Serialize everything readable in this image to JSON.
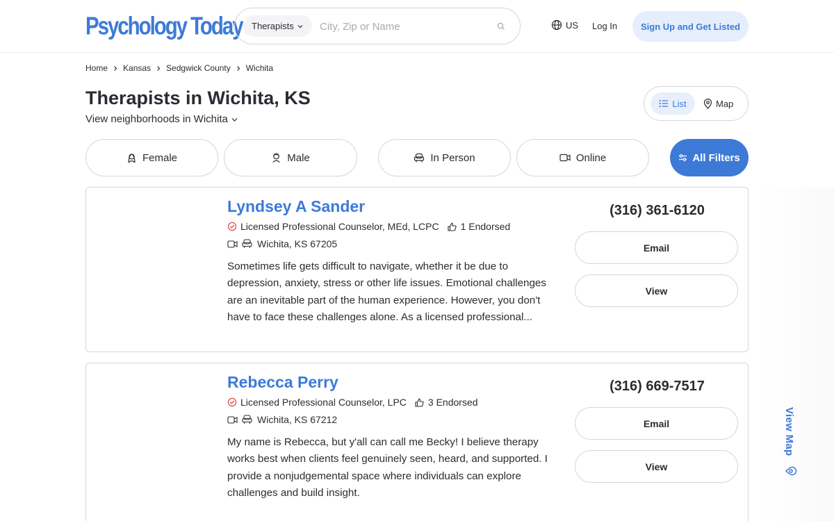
{
  "header": {
    "logo": "Psychology Today",
    "search": {
      "type_label": "Therapists",
      "placeholder": "City, Zip or Name",
      "value": ""
    },
    "country": "US",
    "login_label": "Log In",
    "signup_label": "Sign Up and Get Listed"
  },
  "breadcrumb": [
    "Home",
    "Kansas",
    "Sedgwick County",
    "Wichita"
  ],
  "page_title": "Therapists in Wichita, KS",
  "neighborhoods_label": "View neighborhoods in Wichita",
  "view_toggle": {
    "list": "List",
    "map": "Map"
  },
  "filters": {
    "female": "Female",
    "male": "Male",
    "in_person": "In Person",
    "online": "Online",
    "all": "All Filters"
  },
  "listings": [
    {
      "name": "Lyndsey A Sander",
      "credentials": "Licensed Professional Counselor, MEd, LCPC",
      "endorsed": "1 Endorsed",
      "location": "Wichita, KS 67205",
      "bio": "Sometimes life gets difficult to navigate, whether it be due to depression, anxiety, stress or other life issues. Emotional challenges are an inevitable part of the human experience. However, you don't have to face these challenges alone. As a licensed professional...",
      "phone": "(316) 361-6120",
      "email_label": "Email",
      "view_label": "View"
    },
    {
      "name": "Rebecca Perry",
      "credentials": "Licensed Professional Counselor, LPC",
      "endorsed": "3 Endorsed",
      "location": "Wichita, KS 67212",
      "bio": "My name is Rebecca, but y'all can call me Becky! I believe therapy works best when clients feel genuinely seen, heard, and supported. I provide a nonjudgemental space where individuals can explore challenges and build insight.",
      "phone": "(316) 669-7517",
      "email_label": "Email",
      "view_label": "View"
    }
  ],
  "view_map_label": "View Map",
  "colors": {
    "brand": "#3d7ad8",
    "text": "#2b2b33",
    "border": "#d6d6dc",
    "verified": "#e04646"
  },
  "icons": [
    "chevron-down-icon",
    "search-icon",
    "globe-icon",
    "chevron-right-icon",
    "list-icon",
    "map-pin-icon",
    "female-icon",
    "male-icon",
    "in-person-icon",
    "video-icon",
    "sliders-icon",
    "verified-icon",
    "thumbs-up-icon",
    "map-icon"
  ]
}
